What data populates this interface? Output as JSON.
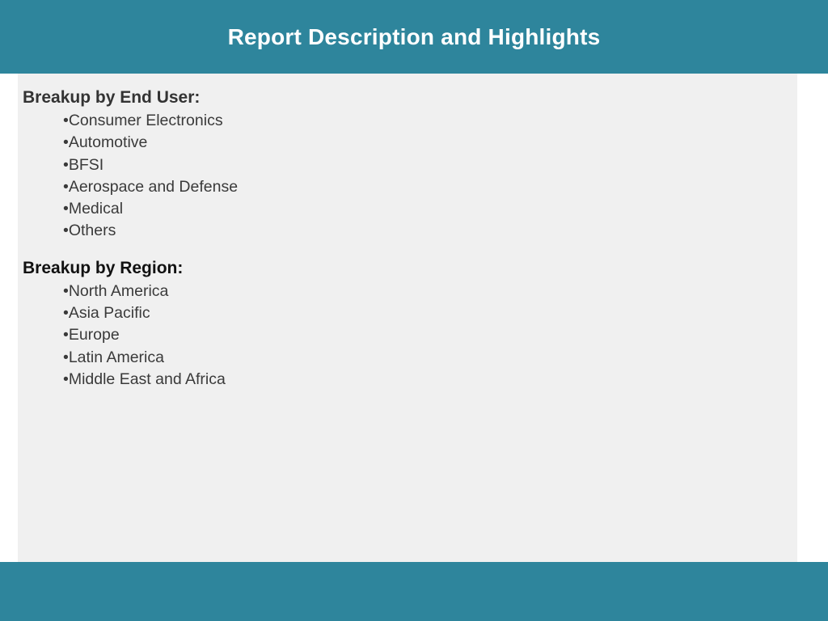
{
  "header": {
    "title": "Report Description and Highlights"
  },
  "sections": [
    {
      "heading": "Breakup by End User:",
      "items": [
        "Consumer Electronics",
        "Automotive",
        "BFSI",
        "Aerospace and Defense",
        "Medical",
        "Others"
      ]
    },
    {
      "heading": "Breakup by Region:",
      "items": [
        "North America",
        "Asia Pacific",
        "Europe",
        "Latin America",
        "Middle East and Africa"
      ]
    }
  ],
  "colors": {
    "band": "#2e859c",
    "panel": "#f0f0f0",
    "text": "#333333"
  }
}
